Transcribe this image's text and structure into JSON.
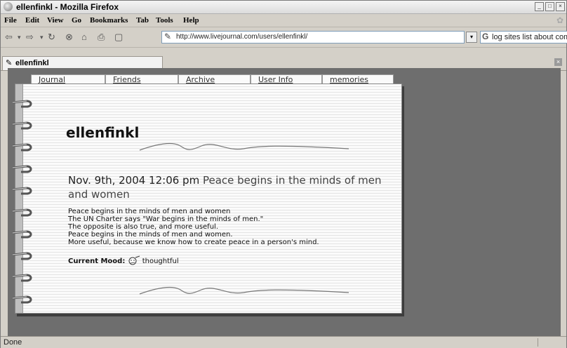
{
  "window": {
    "title": "ellenfinkl - Mozilla Firefox"
  },
  "menu": [
    "File",
    "Edit",
    "View",
    "Go",
    "Bookmarks",
    "Tab",
    "Tools",
    "Help"
  ],
  "nav": {
    "url": "http://www.livejournal.com/users/ellenfinkl/",
    "search_text": "log sites list about com"
  },
  "tab": {
    "label": "ellenfinkl"
  },
  "journal": {
    "tabs": [
      "Journal",
      "Friends",
      "Archive",
      "User Info",
      "memories"
    ],
    "title": "ellenfinkl",
    "entry_date": "Nov. 9th, 2004 12:06 pm",
    "entry_subject": "Peace begins in the minds of men and women",
    "body_lines": [
      "Peace begins in the minds of men and women",
      "The UN Charter says \"War begins in the minds of men.\"",
      "The opposite is also true, and more useful.",
      "Peace begins in the minds of men and women.",
      "More useful, because we know how to create peace in a person's mind."
    ],
    "mood_label": "Current Mood:",
    "mood_value": "thoughtful"
  },
  "status": {
    "text": "Done"
  }
}
